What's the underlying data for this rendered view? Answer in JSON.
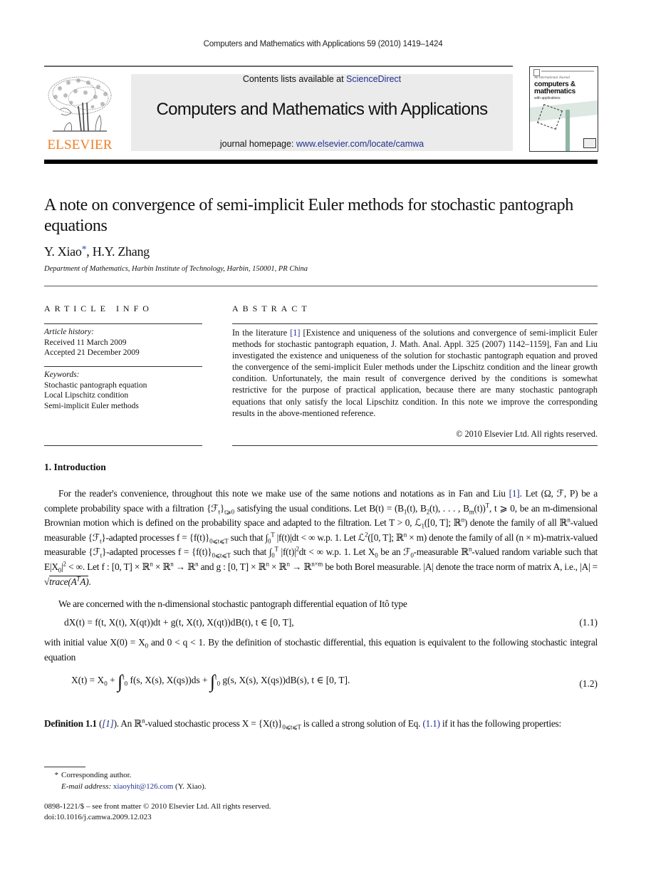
{
  "running_head": "Computers and Mathematics with Applications 59 (2010) 1419–1424",
  "publisher": {
    "logo_word": "ELSEVIER",
    "logo_color": "#f07d24"
  },
  "banner": {
    "contents_prefix": "Contents lists available at ",
    "contents_link": "ScienceDirect",
    "journal_title": "Computers and Mathematics with Applications",
    "homepage_prefix": "journal homepage: ",
    "homepage_link": "www.elsevier.com/locate/camwa",
    "background_color": "#ebebeb",
    "link_color": "#1f2f8f"
  },
  "cover": {
    "kicker": "An International Journal",
    "line1": "computers &",
    "line2": "mathematics",
    "line3": "with applications"
  },
  "article": {
    "title": "A note on convergence of semi-implicit Euler methods for stochastic pantograph equations",
    "authors": [
      {
        "name": "Y. Xiao",
        "mark": "*"
      },
      {
        "name": "H.Y. Zhang",
        "mark": ""
      }
    ],
    "author_separator": ", ",
    "affiliation": "Department of Mathematics, Harbin Institute of Technology, Harbin, 150001, PR China"
  },
  "article_info": {
    "heading": "ARTICLE INFO",
    "history_label": "Article history:",
    "received": "Received 11 March 2009",
    "accepted": "Accepted 21 December 2009",
    "keywords_label": "Keywords:",
    "keywords": [
      "Stochastic pantograph equation",
      "Local Lipschitz condition",
      "Semi-implicit Euler methods"
    ]
  },
  "abstract": {
    "heading": "ABSTRACT",
    "text_before_ref": "In the literature ",
    "ref": "[1]",
    "text_after_ref": " [Existence and uniqueness of the solutions and convergence of semi-implicit Euler methods for stochastic pantograph equation, J. Math. Anal. Appl. 325 (2007) 1142–1159], Fan and Liu investigated the existence and uniqueness of the solution for stochastic pantograph equation and proved the convergence of the semi-implicit Euler methods under the Lipschitz condition and the linear growth condition. Unfortunately, the main result of convergence derived by the conditions is somewhat restrictive for the purpose of practical application, because there are many stochastic pantograph equations that only satisfy the local Lipschitz condition. In this note we improve the corresponding results in the above-mentioned reference.",
    "copyright": "© 2010 Elsevier Ltd. All rights reserved."
  },
  "section1": {
    "heading": "1. Introduction",
    "p1": {
      "s1": "For the reader's convenience, throughout this note we make use of the same notions and notations as in Fan and Liu ",
      "ref": "[1]",
      "s2": ". Let (Ω, ℱ, P) be a complete probability space with a filtration {ℱ",
      "s2_sub": "t",
      "s2_sub2": "t⩾0",
      "s3": " satisfying the usual conditions. Let B(t) = (B",
      "s4": "(t), B",
      "s5": "(t), . . . , B",
      "s6": "(t))",
      "s7": ", t ⩾ 0, be an m-dimensional Brownian motion which is defined on the probability space and adapted to the filtration. Let T > 0, ℒ",
      "s8": "([0, T]; ℝ",
      "s9": ") denote the family of all ℝ",
      "s10": "-valued measurable {ℱ",
      "s11": "}-adapted processes f = {f(t)}",
      "s12": " such that ∫",
      "s13": " |f(t)|dt < ∞ w.p. 1. Let ℒ",
      "s14": "([0, T]; ℝ",
      "s15": " × m) denote the family of all (n × m)-matrix-valued measurable {ℱ",
      "s16": "}-adapted processes f = {f(t)}",
      "s17": " such that ∫",
      "s18": " |f(t)|",
      "s19": "dt < ∞ w.p. 1. Let X",
      "s20": " be an ℱ",
      "s21": "-measurable ℝ",
      "s22": "-valued random variable such that E|X",
      "s23": "|",
      "s24": " < ∞. Let f : [0, T] × ℝ",
      "s25": " × ℝ",
      "s26": " → ℝ",
      "s27": " and g : [0, T] × ℝ",
      "s28": " × ℝ",
      "s29": " → ℝ",
      "s30": " be both Borel measurable. |A| denote the trace norm of matrix A, i.e., |A| = √",
      "s31": "trace(A",
      "s32": "A)",
      "s33": "."
    },
    "p2": "We are concerned with the n-dimensional stochastic pantograph differential equation of Itô type",
    "eq1": {
      "body": "dX(t) = f(t, X(t), X(qt))dt + g(t, X(t), X(qt))dB(t),     t ∈ [0, T],",
      "number": "(1.1)"
    },
    "p3_a": "with initial value X(0) = X",
    "p3_b": " and 0 < q < 1. By the definition of stochastic differential, this equation is equivalent to the following stochastic integral equation",
    "eq2": {
      "lhs": "X(t) = X",
      "part1": " + ",
      "int1_body": "f(s, X(s), X(qs))ds + ",
      "int2_body": "g(s, X(s), X(qs))dB(s),     t ∈ [0, T].",
      "upper": "t",
      "lower": "0",
      "number": "(1.2)"
    },
    "definition": {
      "label": "Definition 1.1",
      "open": " (",
      "ref": "[1]",
      "close": "). An ℝ",
      "t1": "-valued stochastic process X = {X(t)}",
      "t2": " is called a strong solution of Eq. ",
      "eqref": "(1.1)",
      "t3": " if it has the following properties:"
    }
  },
  "footnotes": {
    "mark": "*",
    "corresponding": "Corresponding author.",
    "email_label": "E-mail address: ",
    "email": "xiaoyhit@126.com",
    "email_owner": " (Y. Xiao).",
    "front_matter": "0898-1221/$ – see front matter © 2010 Elsevier Ltd. All rights reserved.",
    "doi": "doi:10.1016/j.camwa.2009.12.023"
  }
}
